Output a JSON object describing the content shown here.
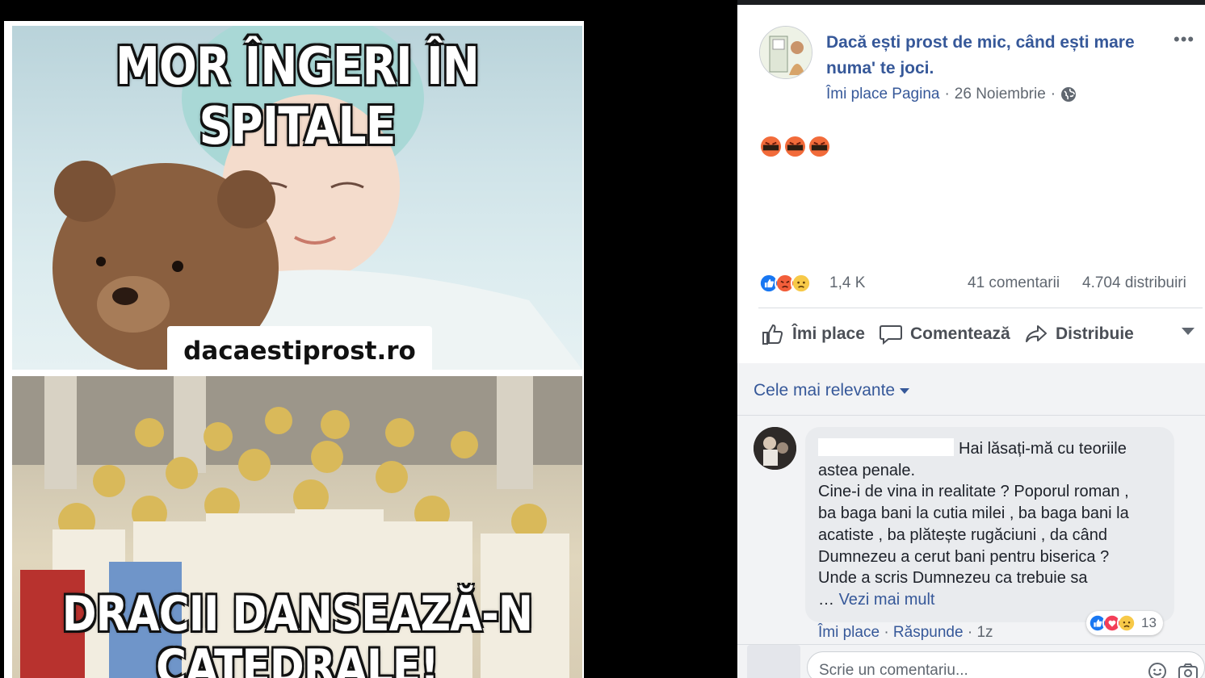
{
  "meme": {
    "caption_top": "MOR ÎNGERI ÎN SPITALE",
    "caption_bottom_line1": "DRACII DANSEAZĂ-N",
    "caption_bottom_line2": "CATEDRALE!",
    "watermark": "dacaestiprost.ro"
  },
  "post": {
    "page_name": "Dacă ești prost de mic, când ești mare numa' te joci.",
    "like_page": "Îmi place Pagina",
    "date": "26 Noiembrie",
    "dot": "·",
    "more": "•••",
    "reactions_count": "1,4 K",
    "comments_count": "41 comentarii",
    "shares_count": "4.704 distribuiri"
  },
  "actions": {
    "like": "Îmi place",
    "comment": "Comentează",
    "share": "Distribuie"
  },
  "comments": {
    "sort_label": "Cele mai relevante",
    "first": {
      "text_line1": "Hai lăsați-mă cu teoriile",
      "text_line2": "astea penale.",
      "text_line3": "Cine-i de vina in realitate ? Poporul roman ,",
      "text_line4": "ba baga bani la cutia milei , ba baga bani la",
      "text_line5": "acatiste , ba plătește rugăciuni , da când",
      "text_line6": "Dumnezeu a cerut bani pentru biserica ?",
      "text_line7": "Unde a scris Dumnezeu ca trebuie sa",
      "ellipsis": "…",
      "see_more": "Vezi mai mult",
      "reaction_count": "13",
      "like": "Îmi place",
      "reply": "Răspunde",
      "time": "1z"
    },
    "write_placeholder": "Scrie un comentariu..."
  },
  "colors": {
    "link": "#365899",
    "muted": "#606770",
    "like_blue": "#1877f2",
    "angry_orange": "#f25e3a",
    "love_red": "#f33e58"
  }
}
